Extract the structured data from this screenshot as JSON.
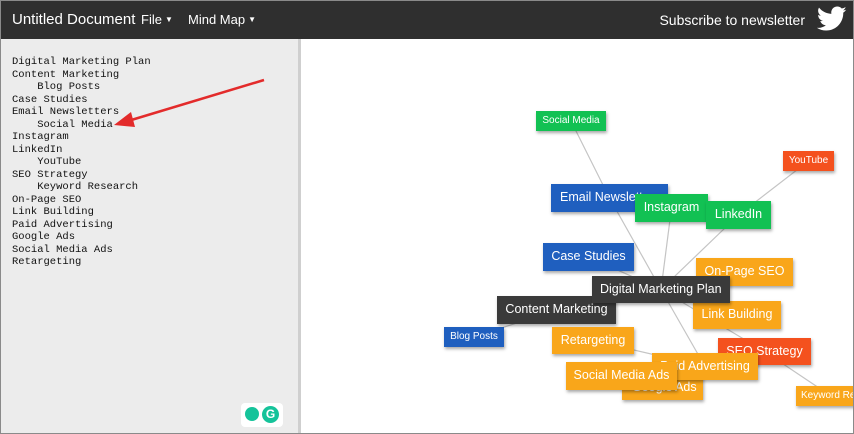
{
  "header": {
    "title": "Untitled Document",
    "menus": [
      {
        "label": "File"
      },
      {
        "label": "Mind Map"
      }
    ],
    "subscribe_label": "Subscribe to newsletter"
  },
  "editor": {
    "lines": [
      "Digital Marketing Plan",
      "Content Marketing",
      "    Blog Posts",
      "Case Studies",
      "Email Newsletters",
      "    Social Media",
      "Instagram",
      "LinkedIn",
      "    YouTube",
      "SEO Strategy",
      "    Keyword Research",
      "On-Page SEO",
      "Link Building",
      "Paid Advertising",
      "Google Ads",
      "Social Media Ads",
      "Retargeting"
    ]
  },
  "mindmap": {
    "nodes": [
      {
        "id": "social-media",
        "label": "Social Media",
        "color": "#12c153"
      },
      {
        "id": "youtube",
        "label": "YouTube",
        "color": "#f4511e"
      },
      {
        "id": "email-newsletters",
        "label": "Email Newsletters",
        "color": "#1f5fbf"
      },
      {
        "id": "case-studies",
        "label": "Case Studies",
        "color": "#1f5fbf"
      },
      {
        "id": "blog-posts",
        "label": "Blog Posts",
        "color": "#1f5fbf"
      },
      {
        "id": "content-marketing",
        "label": "Content Marketing",
        "color": "#3a3a3a"
      },
      {
        "id": "google-ads",
        "label": "Google Ads",
        "color": "#f9a61a"
      },
      {
        "id": "keyword-research",
        "label": "Keyword Research",
        "color": "#f9a61a"
      },
      {
        "id": "seo-strategy",
        "label": "SEO Strategy",
        "color": "#f4511e"
      },
      {
        "id": "paid-advertising",
        "label": "Paid Advertising",
        "color": "#f9a61a"
      },
      {
        "id": "social-media-ads",
        "label": "Social Media Ads",
        "color": "#f9a61a"
      },
      {
        "id": "retargeting",
        "label": "Retargeting",
        "color": "#f9a61a"
      },
      {
        "id": "link-building",
        "label": "Link Building",
        "color": "#f9a61a"
      },
      {
        "id": "on-page-seo",
        "label": "On-Page SEO",
        "color": "#f9a61a"
      },
      {
        "id": "digital-marketing-plan",
        "label": "Digital Marketing Plan",
        "color": "#3a3a3a"
      },
      {
        "id": "instagram",
        "label": "Instagram",
        "color": "#12c153"
      },
      {
        "id": "linkedin",
        "label": "LinkedIn",
        "color": "#12c153"
      }
    ],
    "edges": [
      [
        "digital-marketing-plan",
        "content-marketing"
      ],
      [
        "digital-marketing-plan",
        "case-studies"
      ],
      [
        "digital-marketing-plan",
        "email-newsletters"
      ],
      [
        "digital-marketing-plan",
        "instagram"
      ],
      [
        "digital-marketing-plan",
        "linkedin"
      ],
      [
        "digital-marketing-plan",
        "seo-strategy"
      ],
      [
        "digital-marketing-plan",
        "on-page-seo"
      ],
      [
        "digital-marketing-plan",
        "link-building"
      ],
      [
        "digital-marketing-plan",
        "paid-advertising"
      ],
      [
        "content-marketing",
        "blog-posts"
      ],
      [
        "email-newsletters",
        "social-media"
      ],
      [
        "linkedin",
        "youtube"
      ],
      [
        "seo-strategy",
        "keyword-research"
      ],
      [
        "paid-advertising",
        "google-ads"
      ],
      [
        "paid-advertising",
        "social-media-ads"
      ],
      [
        "paid-advertising",
        "retargeting"
      ]
    ]
  }
}
